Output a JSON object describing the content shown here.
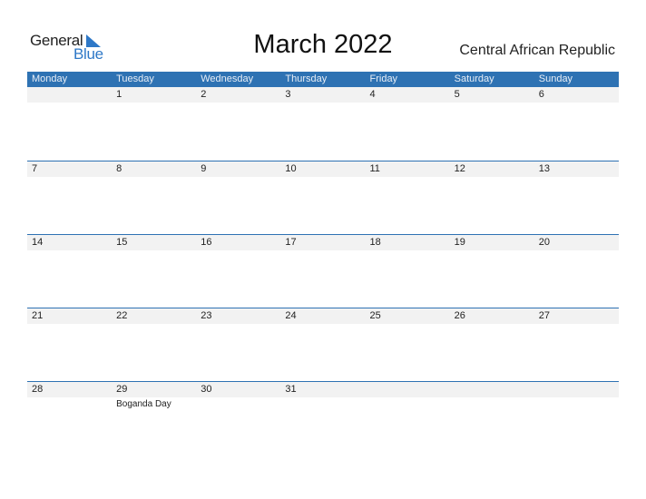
{
  "logo": {
    "word1": "General",
    "word2": "Blue"
  },
  "title": "March 2022",
  "country": "Central African Republic",
  "colors": {
    "accent": "#2e72b3",
    "daystrip": "#f2f2f2"
  },
  "weekdays": [
    "Monday",
    "Tuesday",
    "Wednesday",
    "Thursday",
    "Friday",
    "Saturday",
    "Sunday"
  ],
  "weeks": [
    {
      "days": [
        "",
        "1",
        "2",
        "3",
        "4",
        "5",
        "6"
      ],
      "events": [
        "",
        "",
        "",
        "",
        "",
        "",
        ""
      ]
    },
    {
      "days": [
        "7",
        "8",
        "9",
        "10",
        "11",
        "12",
        "13"
      ],
      "events": [
        "",
        "",
        "",
        "",
        "",
        "",
        ""
      ]
    },
    {
      "days": [
        "14",
        "15",
        "16",
        "17",
        "18",
        "19",
        "20"
      ],
      "events": [
        "",
        "",
        "",
        "",
        "",
        "",
        ""
      ]
    },
    {
      "days": [
        "21",
        "22",
        "23",
        "24",
        "25",
        "26",
        "27"
      ],
      "events": [
        "",
        "",
        "",
        "",
        "",
        "",
        ""
      ]
    },
    {
      "days": [
        "28",
        "29",
        "30",
        "31",
        "",
        "",
        ""
      ],
      "events": [
        "",
        "Boganda Day",
        "",
        "",
        "",
        "",
        ""
      ]
    }
  ]
}
